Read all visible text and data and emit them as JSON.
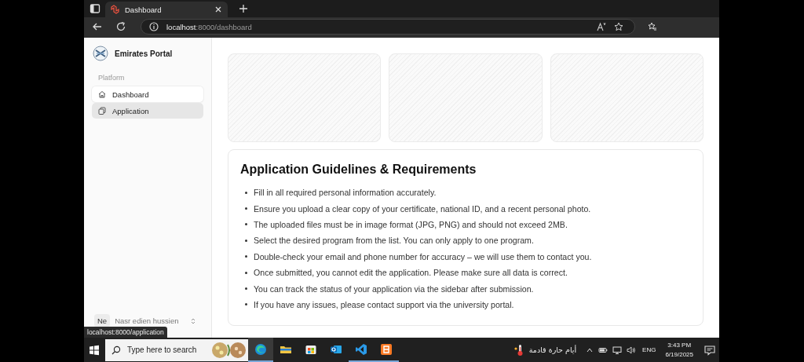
{
  "browser": {
    "tab_title": "Dashboard",
    "url_host": "localhost",
    "url_path": ":8000/dashboard"
  },
  "sidebar": {
    "app_name": "Emirates Portal",
    "section_label": "Platform",
    "items": [
      {
        "label": "Dashboard",
        "kind": "home",
        "selected": true,
        "hovered": false
      },
      {
        "label": "Application",
        "kind": "copy",
        "selected": false,
        "hovered": true
      }
    ],
    "user": {
      "initials": "Ne",
      "name": "Nasr edien hussien"
    }
  },
  "placeholder_cards": [
    {
      "kind": "pattern"
    },
    {
      "kind": "pattern"
    },
    {
      "kind": "pattern"
    }
  ],
  "guidelines": {
    "title": "Application Guidelines & Requirements",
    "items": [
      "Fill in all required personal information accurately.",
      "Ensure you upload a clear copy of your certificate, national ID, and a recent personal photo.",
      "The uploaded files must be in image format (JPG, PNG) and should not exceed 2MB.",
      "Select the desired program from the list. You can only apply to one program.",
      "Double-check your email and phone number for accuracy – we will use them to contact you.",
      "Once submitted, you cannot edit the application. Please make sure all data is correct.",
      "You can track the status of your application via the sidebar after submission.",
      "If you have any issues, please contact support via the university portal."
    ]
  },
  "status_tooltip": "localhost:8000/application",
  "taskbar": {
    "search_placeholder": "Type here to search",
    "apps": [
      {
        "kind": "edge",
        "selected": true,
        "running": true
      },
      {
        "kind": "explorer",
        "selected": false,
        "running": false
      },
      {
        "kind": "store",
        "selected": false,
        "running": false
      },
      {
        "kind": "outlook",
        "selected": false,
        "running": false
      },
      {
        "kind": "vscode",
        "selected": false,
        "running": true
      },
      {
        "kind": "xampp",
        "selected": false,
        "running": true
      }
    ],
    "weather": "أيام حارة قادمة",
    "language": "ENG",
    "time": "3:43 PM",
    "date": "6/19/2025"
  }
}
